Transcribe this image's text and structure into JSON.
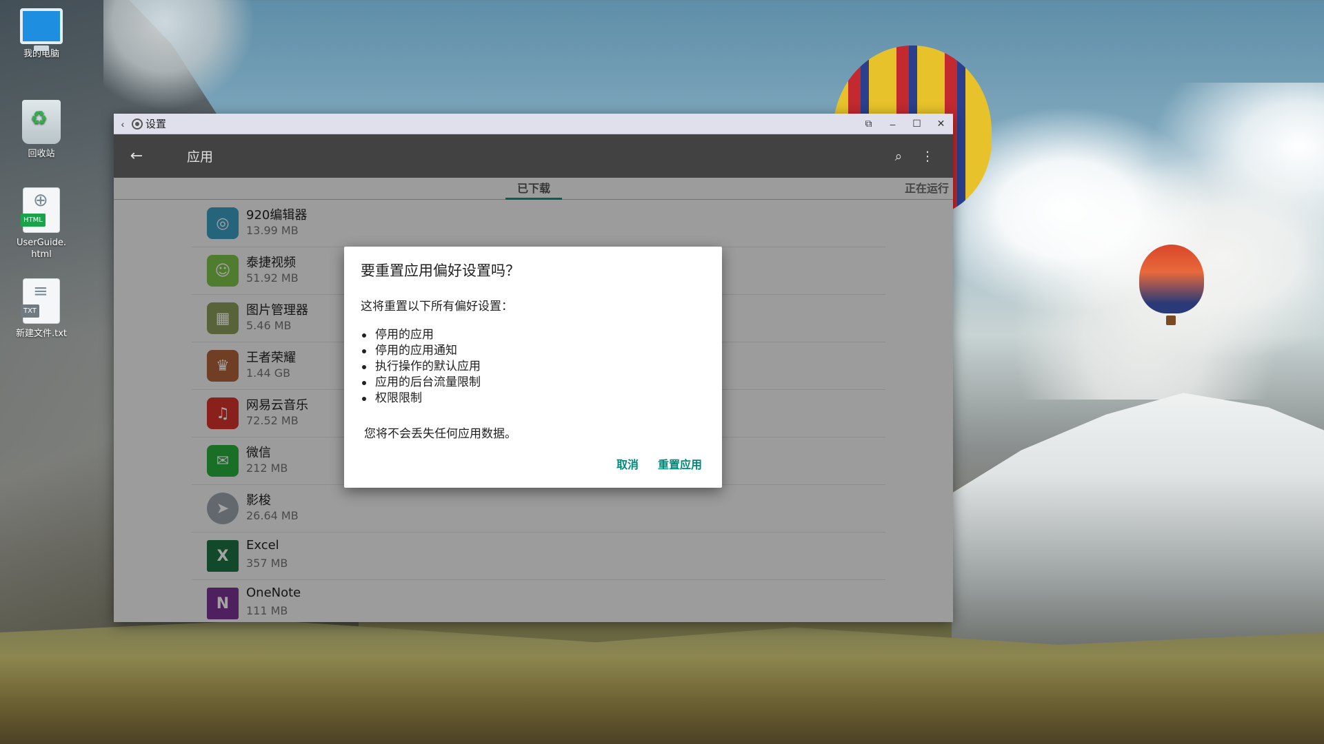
{
  "desktop": {
    "icons": [
      {
        "label": "我的电脑",
        "icon": "computer-icon"
      },
      {
        "label": "回收站",
        "icon": "recycle-bin-icon"
      },
      {
        "label": "UserGuide.html",
        "icon": "html-file-icon",
        "tag": "HTML"
      },
      {
        "label": "新建文件.txt",
        "icon": "text-file-icon",
        "tag": "TXT"
      }
    ]
  },
  "window": {
    "title": "设置",
    "controls": {
      "back": "‹",
      "pin": "⧉",
      "minimize": "–",
      "maximize": "☐",
      "close": "✕"
    }
  },
  "appbar": {
    "back": "←",
    "title": "应用",
    "search": "⌕",
    "more": "⋮"
  },
  "tabs": {
    "downloaded": "已下载",
    "running": "正在运行"
  },
  "apps": [
    {
      "name": "920编辑器",
      "size": "13.99 MB",
      "icon": "editor-icon",
      "color": "#3a9dc0",
      "glyph": "◎"
    },
    {
      "name": "泰捷视频",
      "size": "51.92 MB",
      "icon": "video-app-icon",
      "color": "#7cc24a",
      "glyph": "☺"
    },
    {
      "name": "图片管理器",
      "size": "5.46 MB",
      "icon": "gallery-icon",
      "color": "#8c9b5a",
      "glyph": "▦"
    },
    {
      "name": "王者荣耀",
      "size": "1.44 GB",
      "icon": "game-icon",
      "color": "#b0623a",
      "glyph": "♛"
    },
    {
      "name": "网易云音乐",
      "size": "72.52 MB",
      "icon": "music-icon",
      "color": "#d8322c",
      "glyph": "♫"
    },
    {
      "name": "微信",
      "size": "212 MB",
      "icon": "wechat-icon",
      "color": "#2aae3c",
      "glyph": "✉"
    },
    {
      "name": "影梭",
      "size": "26.64 MB",
      "icon": "paper-plane-icon",
      "color": "#9aa3ab",
      "glyph": "➤"
    },
    {
      "name": "Excel",
      "size": "357 MB",
      "icon": "excel-icon",
      "color": "#1f7244",
      "glyph": "X"
    },
    {
      "name": "OneNote",
      "size": "111 MB",
      "icon": "onenote-icon",
      "color": "#7b3294",
      "glyph": "N"
    }
  ],
  "dialog": {
    "title": "要重置应用偏好设置吗？",
    "intro": "这将重置以下所有偏好设置：",
    "items": [
      "停用的应用",
      "停用的应用通知",
      "执行操作的默认应用",
      "应用的后台流量限制",
      "权限限制"
    ],
    "note": "您将不会丢失任何应用数据。",
    "cancel": "取消",
    "reset": "重置应用"
  },
  "colors": {
    "accent": "#009688",
    "appbar": "#424242",
    "titlebar": "#e0e0ec"
  }
}
